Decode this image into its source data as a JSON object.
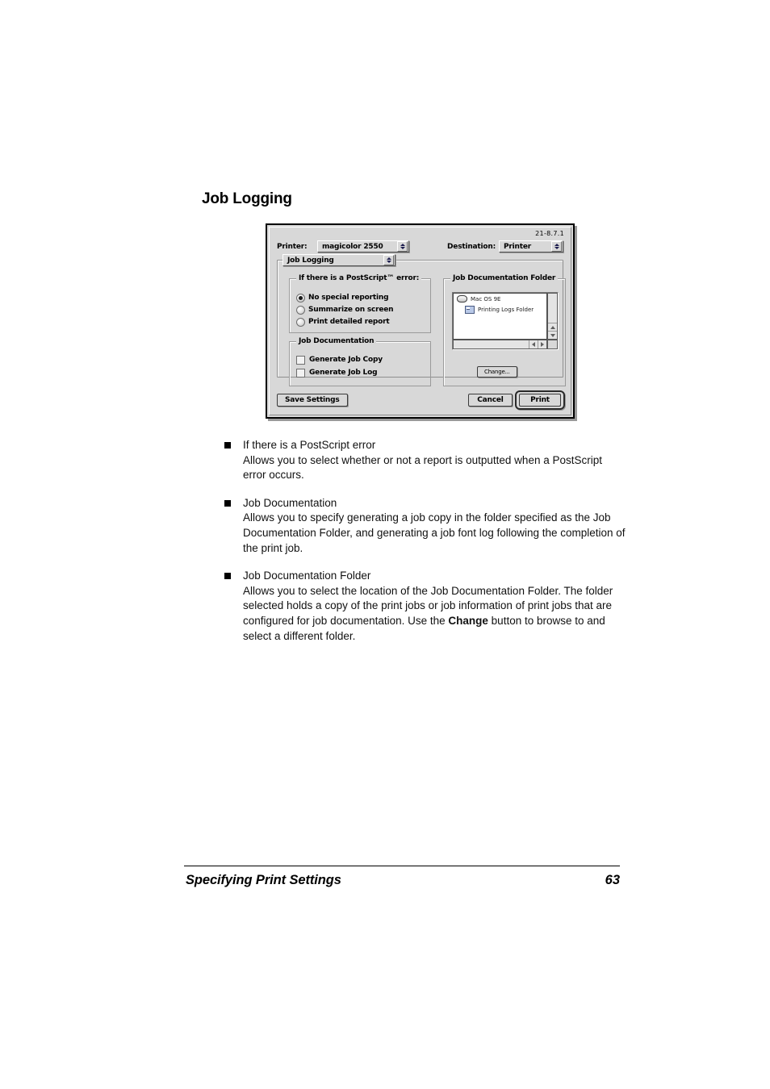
{
  "page": {
    "heading": "Job Logging",
    "footer_title": "Specifying Print Settings",
    "footer_page_number": "63"
  },
  "dialog": {
    "version": "21-8.7.1",
    "printer_label": "Printer:",
    "printer_value": "magicolor 2550",
    "destination_label": "Destination:",
    "destination_value": "Printer",
    "pane_value": "Job Logging",
    "ps_error_group": {
      "title": "If there is a PostScript™ error:",
      "options": [
        {
          "label": "No special reporting",
          "selected": true
        },
        {
          "label": "Summarize on screen",
          "selected": false
        },
        {
          "label": "Print detailed report",
          "selected": false
        }
      ]
    },
    "job_documentation_group": {
      "title": "Job Documentation",
      "checkboxes": [
        {
          "label": "Generate Job Copy",
          "checked": false
        },
        {
          "label": "Generate Job Log",
          "checked": false
        }
      ]
    },
    "job_documentation_folder_group": {
      "title": "Job Documentation Folder",
      "items": [
        {
          "label": "Mac OS 9E",
          "icon": "disk-icon"
        },
        {
          "label": "Printing Logs Folder",
          "icon": "folder-icon"
        }
      ],
      "change_button": "Change..."
    },
    "buttons": {
      "save_settings": "Save Settings",
      "cancel": "Cancel",
      "print": "Print"
    }
  },
  "body": {
    "bullets": [
      {
        "term": "If there is a PostScript error",
        "desc": "Allows you to select whether or not a report is outputted when a PostScript error occurs."
      },
      {
        "term": "Job Documentation",
        "desc": "Allows you to specify generating a job copy in the folder specified as the Job Documentation Folder, and generating a job font log following the completion of the print job."
      },
      {
        "term": "Job Documentation Folder",
        "desc_pre": "Allows you to select the location of the Job Documentation Folder. The folder selected holds a copy of the print jobs or job information of print jobs that are configured for job documentation. Use the ",
        "desc_bold": "Change",
        "desc_post": " button to browse to and select a different folder."
      }
    ]
  }
}
